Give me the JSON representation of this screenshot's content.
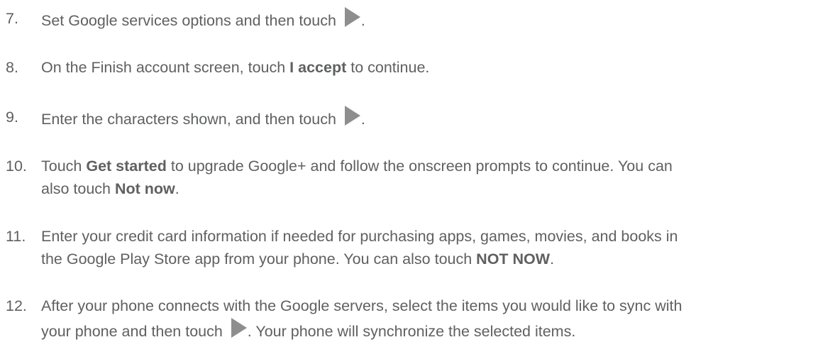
{
  "steps": [
    {
      "number": "7.",
      "parts": [
        "Set Google services options and then touch ",
        "."
      ],
      "icon": "next-arrow-icon"
    },
    {
      "number": "8.",
      "parts": [
        "On the Finish account screen, touch ",
        "I accept",
        " to continue."
      ]
    },
    {
      "number": "9.",
      "parts": [
        "Enter the characters shown, and then touch ",
        "."
      ],
      "icon": "next-arrow-icon"
    },
    {
      "number": "10.",
      "parts": [
        "Touch ",
        "Get started",
        " to upgrade Google+ and follow the onscreen prompts to continue. You can",
        "also touch ",
        "Not now",
        "."
      ]
    },
    {
      "number": "11.",
      "parts": [
        "Enter your credit card information if needed for purchasing apps, games, movies, and books in",
        "the Google Play Store app from your phone. You can also touch ",
        "NOT NOW",
        "."
      ]
    },
    {
      "number": "12.",
      "parts": [
        "After your phone connects with the Google servers, select the items you would like to sync with",
        "your phone and then touch ",
        ". Your phone will synchronize the selected items."
      ],
      "icon": "next-arrow-icon"
    }
  ],
  "colors": {
    "text": "#5f6061",
    "icon": "#8e8e8e"
  }
}
